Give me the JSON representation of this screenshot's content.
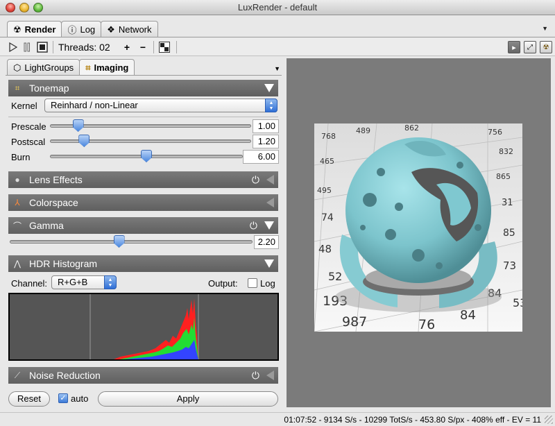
{
  "window": {
    "title": "LuxRender - default"
  },
  "main_tabs": [
    {
      "label": "Render",
      "icon": "radiation-icon",
      "active": true
    },
    {
      "label": "Log",
      "icon": "info-icon",
      "active": false
    },
    {
      "label": "Network",
      "icon": "network-icon",
      "active": false
    }
  ],
  "toolbar": {
    "threads_label": "Threads: 02",
    "plus": "+",
    "minus": "−"
  },
  "sub_tabs": [
    {
      "label": "LightGroups",
      "icon": "lightgroups-icon",
      "active": false
    },
    {
      "label": "Imaging",
      "icon": "imaging-icon",
      "active": true
    }
  ],
  "tonemap": {
    "title": "Tonemap",
    "kernel_label": "Kernel",
    "kernel_value": "Reinhard / non-Linear",
    "prescale_label": "Prescale",
    "prescale_value": "1.00",
    "postscale_label": "Postscal",
    "postscale_value": "1.20",
    "burn_label": "Burn",
    "burn_value": "6.00"
  },
  "lens_effects": {
    "title": "Lens Effects"
  },
  "colorspace": {
    "title": "Colorspace"
  },
  "gamma": {
    "title": "Gamma",
    "value": "2.20"
  },
  "hdr_histogram": {
    "title": "HDR Histogram",
    "channel_label": "Channel:",
    "channel_value": "R+G+B",
    "output_label": "Output:",
    "log_label": "Log",
    "log_checked": false
  },
  "noise_reduction": {
    "title": "Noise Reduction"
  },
  "footer": {
    "reset_label": "Reset",
    "auto_label": "auto",
    "auto_checked": true,
    "apply_label": "Apply"
  },
  "render": {
    "numbers": [
      "768",
      "489",
      "862",
      "756",
      "465",
      "832",
      "495",
      "865",
      "74",
      "31",
      "48",
      "85",
      "52",
      "73",
      "84",
      "193",
      "987",
      "76",
      "84",
      "53"
    ]
  },
  "status": {
    "text": "01:07:52 - 9134 S/s - 10299 TotS/s - 453.80 S/px - 408% eff - EV = 11"
  },
  "colors": {
    "section_header": "#666666",
    "accent_blue": "#3c7ad8",
    "histogram_bg": "#555555",
    "sphere": "#7fc8d0"
  }
}
